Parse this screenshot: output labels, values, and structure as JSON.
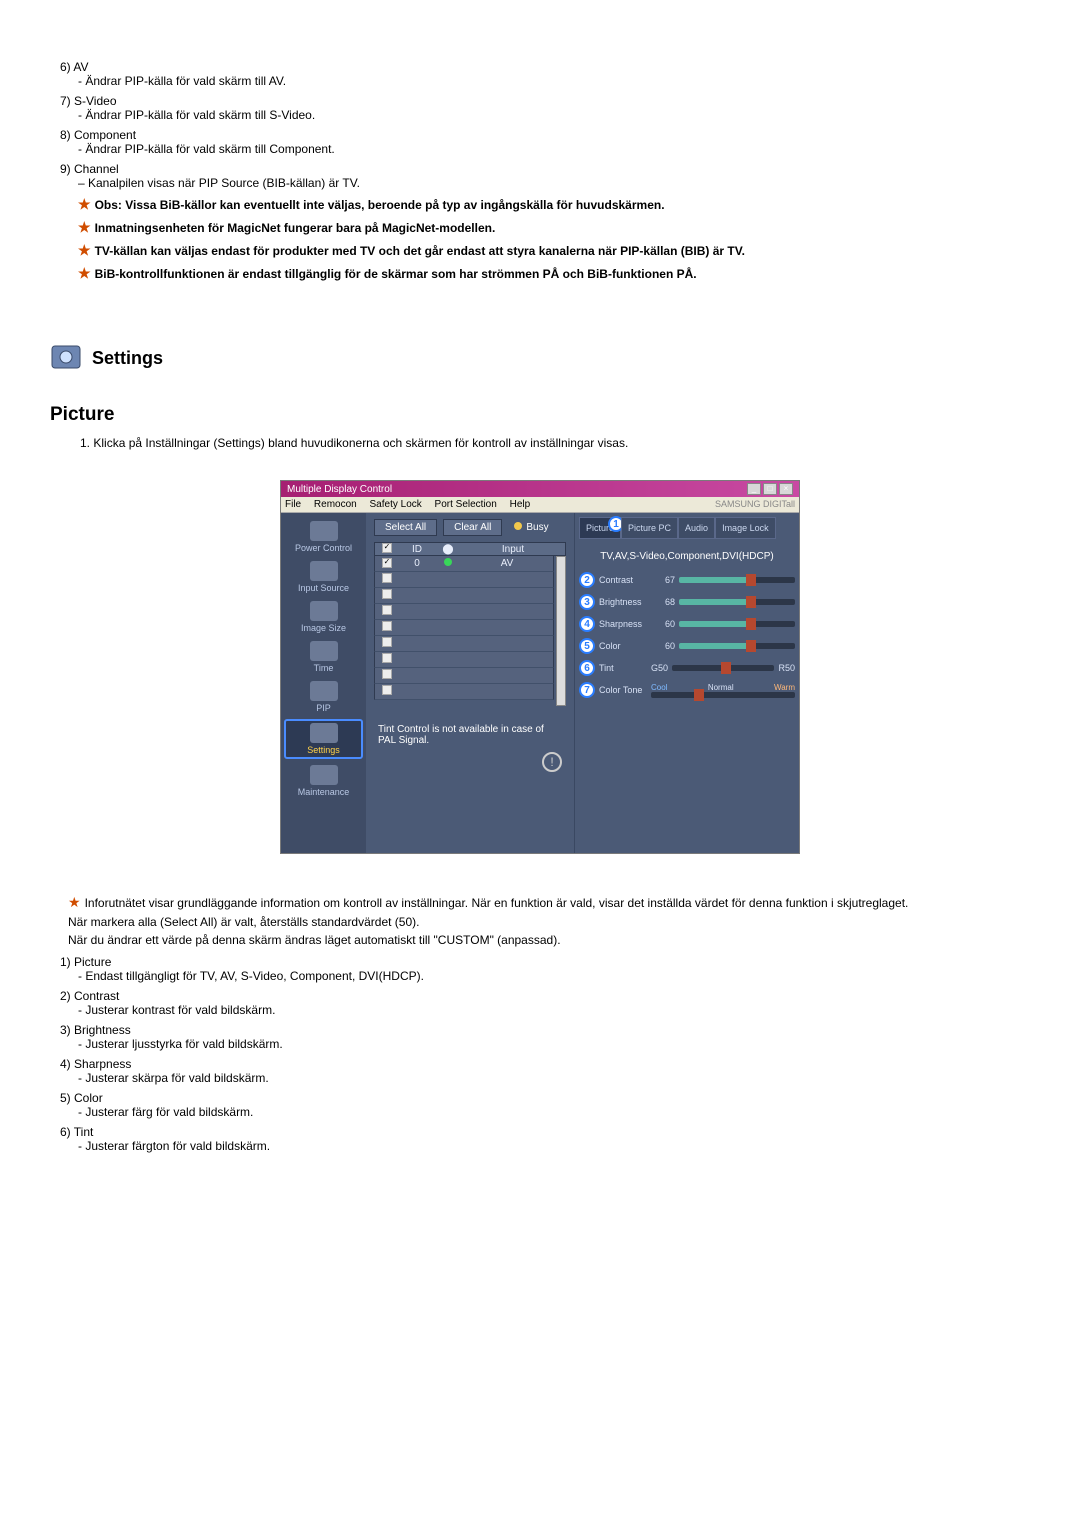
{
  "top_list": {
    "items": [
      {
        "num": "6)",
        "label": "AV",
        "desc": "- Ändrar PIP-källa för vald skärm till AV."
      },
      {
        "num": "7)",
        "label": "S-Video",
        "desc": "- Ändrar PIP-källa för vald skärm till S-Video."
      },
      {
        "num": "8)",
        "label": "Component",
        "desc": "- Ändrar PIP-källa för vald skärm till Component."
      },
      {
        "num": "9)",
        "label": "Channel",
        "desc": "– Kanalpilen visas när PIP Source (BIB-källan) är TV."
      }
    ]
  },
  "notes": {
    "n1": "Obs: Vissa BiB-källor kan eventuellt inte väljas, beroende på typ av ingångskälla för huvudskärmen.",
    "n2": "Inmatningsenheten för MagicNet fungerar bara på MagicNet-modellen.",
    "n3": "TV-källan kan väljas endast för produkter med TV och det går endast att styra kanalerna när PIP-källan (BIB) är TV.",
    "n4": "BiB-kontrollfunktionen är endast tillgänglig för de skärmar som har strömmen PÅ och BiB-funktionen PÅ."
  },
  "settings": {
    "title": "Settings",
    "picture_title": "Picture",
    "intro_num": "1.",
    "intro": "Klicka på Inställningar (Settings) bland huvudikonerna och skärmen för kontroll av inställningar visas."
  },
  "app": {
    "title": "Multiple Display Control",
    "menus": {
      "file": "File",
      "remocon": "Remocon",
      "safety": "Safety Lock",
      "port": "Port Selection",
      "help": "Help"
    },
    "brand": "SAMSUNG DIGITall",
    "sidebar": {
      "power": "Power Control",
      "input": "Input Source",
      "image": "Image Size",
      "time": "Time",
      "pip": "PIP",
      "settings": "Settings",
      "maintenance": "Maintenance"
    },
    "actions": {
      "select_all": "Select All",
      "clear_all": "Clear All",
      "busy": "Busy"
    },
    "grid": {
      "id_col": "ID",
      "input_col": "Input",
      "row0_id": "0",
      "row0_input": "AV"
    },
    "tabs": {
      "picture": "Picture",
      "picture_pc": "Picture PC",
      "audio": "Audio",
      "image_lock": "Image Lock"
    },
    "mode_label": "TV,AV,S-Video,Component,DVI(HDCP)",
    "sliders": {
      "contrast": {
        "num": "2",
        "label": "Contrast",
        "val": "67"
      },
      "brightness": {
        "num": "3",
        "label": "Brightness",
        "val": "68"
      },
      "sharpness": {
        "num": "4",
        "label": "Sharpness",
        "val": "60"
      },
      "color": {
        "num": "5",
        "label": "Color",
        "val": "60"
      },
      "tint": {
        "num": "6",
        "label": "Tint",
        "val_l": "G50",
        "val_r": "R50"
      },
      "tone": {
        "num": "7",
        "label": "Color Tone",
        "cool": "Cool",
        "normal": "Normal",
        "warm": "Warm"
      }
    },
    "status_note": "Tint Control is not available in case of PAL Signal.",
    "tab_badge": "1"
  },
  "after": {
    "info": "Inforutnätet visar grundläggande information om kontroll av inställningar. När en funktion är vald, visar det inställda värdet för denna funktion i skjutreglaget.",
    "line2": "När markera alla (Select All) är valt, återställs standardvärdet (50).",
    "line3": "När du ändrar ett värde på denna skärm ändras läget automatiskt till \"CUSTOM\" (anpassad).",
    "items": [
      {
        "num": "1)",
        "label": "Picture",
        "desc": "- Endast tillgängligt för TV, AV, S-Video, Component, DVI(HDCP)."
      },
      {
        "num": "2)",
        "label": "Contrast",
        "desc": "- Justerar kontrast för vald bildskärm."
      },
      {
        "num": "3)",
        "label": "Brightness",
        "desc": "- Justerar ljusstyrka för vald bildskärm."
      },
      {
        "num": "4)",
        "label": "Sharpness",
        "desc": "- Justerar skärpa för vald bildskärm."
      },
      {
        "num": "5)",
        "label": "Color",
        "desc": "- Justerar färg för vald bildskärm."
      },
      {
        "num": "6)",
        "label": "Tint",
        "desc": "- Justerar färgton för vald bildskärm."
      }
    ]
  }
}
